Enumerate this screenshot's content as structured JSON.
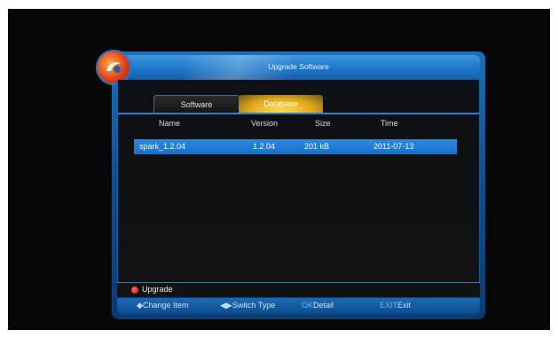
{
  "window": {
    "title": "Upgrade Software"
  },
  "tabs": [
    {
      "label": "Software",
      "active": false
    },
    {
      "label": "Database",
      "active": true
    }
  ],
  "table": {
    "headers": [
      "Name",
      "Version",
      "Size",
      "Time"
    ],
    "rows": [
      {
        "name": "spark_1.2.04",
        "version": "1.2.04",
        "size": "201 kB",
        "time": "2011-07-13"
      }
    ]
  },
  "action": {
    "label": "Upgrade",
    "color": "#cc1111"
  },
  "footer": {
    "change_item_key": "◆",
    "change_item": "Change Item",
    "switch_type_key": "◀▶",
    "switch_type": "Switch Type",
    "detail_key": "OK",
    "detail": "Detail",
    "exit_key": "EXIT",
    "exit": "Exit"
  },
  "colors": {
    "panel_blue": "#1c6fb6",
    "selection": "#1a6fc8",
    "active_tab": "#e0a81a"
  }
}
